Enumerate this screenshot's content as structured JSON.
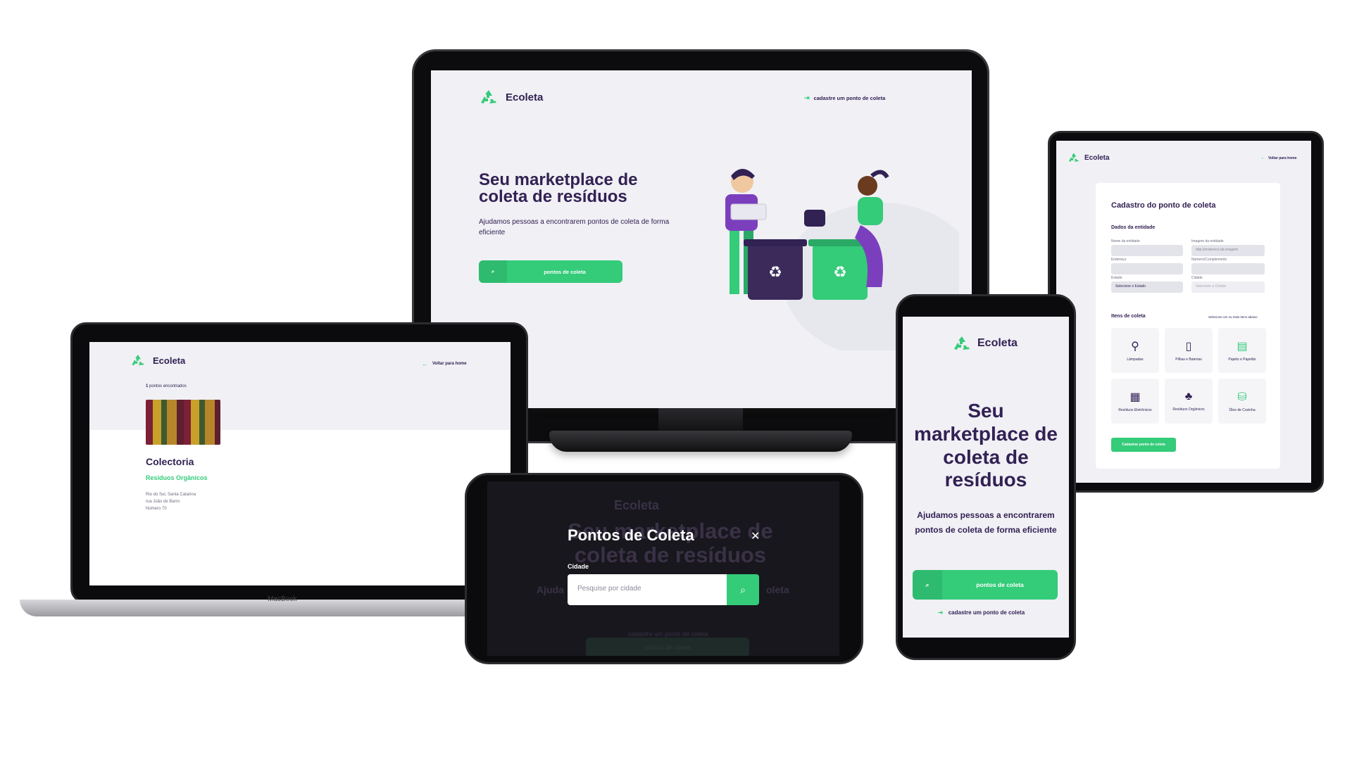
{
  "brand": {
    "name": "Ecoleta",
    "green": "#34cb79",
    "purple": "#322153"
  },
  "monitor": {
    "header_link": "cadastre um ponto de coleta",
    "title": "Seu marketplace de coleta de resíduos",
    "subtitle": "Ajudamos pessoas a encontrarem pontos de coleta de forma eficiente",
    "cta": "pontos de coleta"
  },
  "laptop": {
    "back_link": "Voltar para home",
    "results_count": "1",
    "results_suffix": "pontos encontrados",
    "card": {
      "name": "Colectoria",
      "category": "Resíduos Orgânicos",
      "address_lines": [
        "Rio do Sul, Santa Catarina",
        "rua João de Barro",
        "Número 70"
      ]
    },
    "device_label": "MacBook"
  },
  "tablet": {
    "back_link": "Voltar para home",
    "form_title": "Cadastro do ponto de coleta",
    "section_entity": "Dados da entidade",
    "labels": {
      "name": "Nome da entidade",
      "image": "Imagem da entidade",
      "address": "Endereço",
      "number": "Número/Complemento",
      "state": "Estado",
      "city": "Cidade"
    },
    "placeholders": {
      "image": "http://endereco-da-imagem",
      "state": "Selecione o Estado",
      "city": "Selecione a Cidade"
    },
    "section_items": "Itens de coleta",
    "items_hint": "Selecione um ou mais itens abaixo",
    "items": [
      "Lâmpadas",
      "Pilhas e Baterias",
      "Papéis e Papelão",
      "Resíduos Eletrônicos",
      "Resíduos Orgânicos",
      "Óleo de Cozinha"
    ],
    "submit": "Cadastrar ponto de coleta"
  },
  "lphone": {
    "bg_brand": "Ecoleta",
    "bg_title": "Seu marketplace de coleta de resíduos",
    "bg_sub_left": "Ajuda",
    "bg_sub_right": "oleta",
    "bg_link": "cadastre um ponto de coleta",
    "bg_cta": "pontos de coleta",
    "modal_title": "Pontos de Coleta",
    "city_label": "Cidade",
    "search_placeholder": "Pesquise por cidade"
  },
  "pphone": {
    "title": "Seu marketplace de coleta de resíduos",
    "subtitle": "Ajudamos pessoas a encontrarem pontos de coleta de forma eficiente",
    "cta": "pontos de coleta",
    "link": "cadastre um ponto de coleta"
  }
}
